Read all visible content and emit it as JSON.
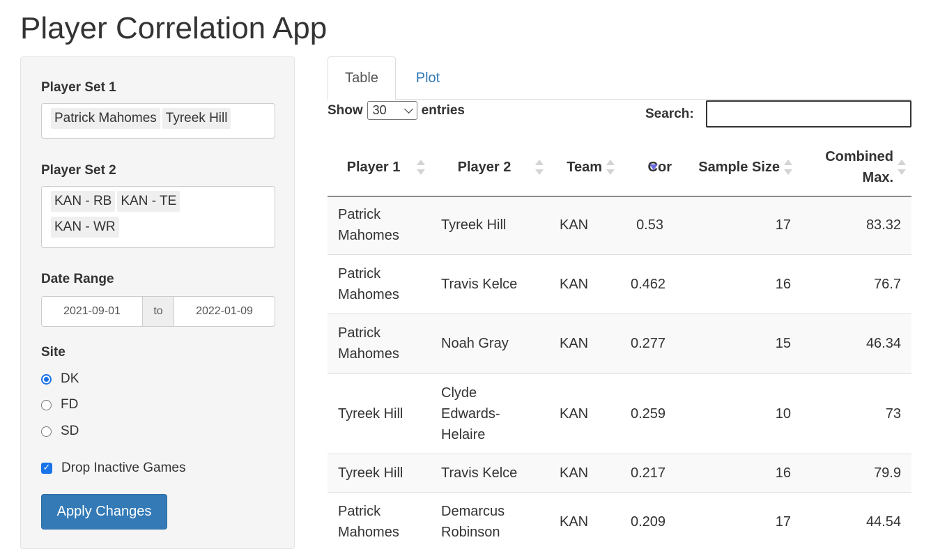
{
  "app": {
    "title": "Player Correlation App"
  },
  "sidebar": {
    "player_set_1": {
      "label": "Player Set 1",
      "items": [
        "Patrick Mahomes",
        "Tyreek Hill"
      ]
    },
    "player_set_2": {
      "label": "Player Set 2",
      "items": [
        "KAN - RB",
        "KAN - TE",
        "KAN - WR"
      ]
    },
    "date_range": {
      "label": "Date Range",
      "start": "2021-09-01",
      "separator": "to",
      "end": "2022-01-09"
    },
    "site": {
      "label": "Site",
      "options": [
        "DK",
        "FD",
        "SD"
      ],
      "selected": "DK"
    },
    "drop_inactive": {
      "label": "Drop Inactive Games",
      "checked": true
    },
    "apply_button": "Apply Changes"
  },
  "tabs": [
    {
      "label": "Table",
      "active": true
    },
    {
      "label": "Plot",
      "active": false
    }
  ],
  "table_controls": {
    "show_label": "Show",
    "page_length": "30",
    "entries_label": "entries",
    "search_label": "Search:",
    "search_value": ""
  },
  "table": {
    "headers": [
      "Player 1",
      "Player 2",
      "Team",
      "Cor",
      "Sample Size",
      "Combined Max."
    ],
    "sorted_column": "Cor",
    "sort_direction": "descending",
    "rows": [
      [
        "Patrick Mahomes",
        "Tyreek Hill",
        "KAN",
        "0.53",
        "17",
        "83.32"
      ],
      [
        "Patrick Mahomes",
        "Travis Kelce",
        "KAN",
        "0.462",
        "16",
        "76.7"
      ],
      [
        "Patrick Mahomes",
        "Noah Gray",
        "KAN",
        "0.277",
        "15",
        "46.34"
      ],
      [
        "Tyreek Hill",
        "Clyde Edwards-Helaire",
        "KAN",
        "0.259",
        "10",
        "73"
      ],
      [
        "Tyreek Hill",
        "Travis Kelce",
        "KAN",
        "0.217",
        "16",
        "79.9"
      ],
      [
        "Patrick Mahomes",
        "Demarcus Robinson",
        "KAN",
        "0.209",
        "17",
        "44.54"
      ]
    ]
  },
  "colors": {
    "primary": "#337ab7",
    "radio_accent": "#1a73e8",
    "sort_active": "#6b6be0"
  }
}
